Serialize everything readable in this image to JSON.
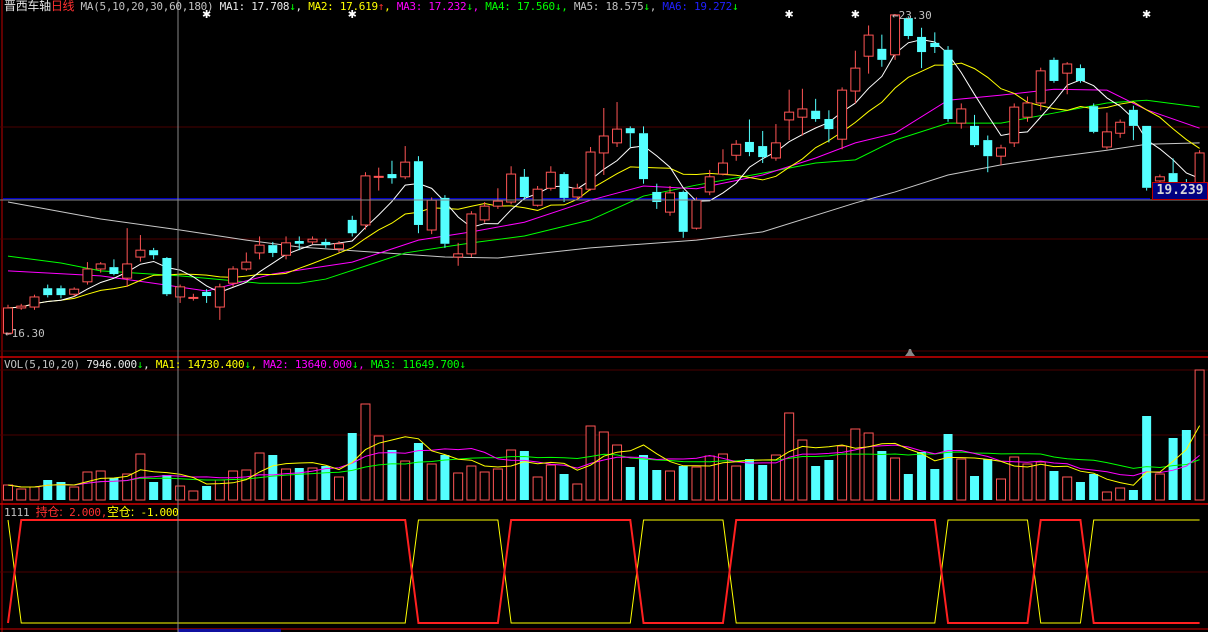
{
  "header": {
    "stock_name": "晋西车轴",
    "period": "日线",
    "ma_label": "MA(5,10,20,30,60,180)",
    "ma": [
      {
        "label": "MA1:",
        "value": "17.708",
        "arrow": "↓"
      },
      {
        "label": "MA2:",
        "value": "17.619",
        "arrow": "↑"
      },
      {
        "label": "MA3:",
        "value": "17.232",
        "arrow": "↓"
      },
      {
        "label": "MA4:",
        "value": "17.560",
        "arrow": "↓"
      },
      {
        "label": "MA5:",
        "value": "18.575",
        "arrow": "↓"
      },
      {
        "label": "MA6:",
        "value": "19.272",
        "arrow": "↓"
      }
    ]
  },
  "volume_header": {
    "label": "VOL(5,10,20)",
    "value": "7946.000",
    "arrow": "↓",
    "ma": [
      {
        "label": "MA1:",
        "value": "14730.400",
        "arrow": "↓"
      },
      {
        "label": "MA2:",
        "value": "13640.000",
        "arrow": "↓"
      },
      {
        "label": "MA3:",
        "value": "11649.700",
        "arrow": "↓"
      }
    ]
  },
  "indicator_header": {
    "name": "1111",
    "hold_label": "持仓:",
    "hold_value": "2.000,",
    "empty_label": "空仓:",
    "empty_value": "-1.000"
  },
  "price_labels": {
    "high": "23.30",
    "low": "16.30",
    "crosshair": "19.239"
  },
  "colors": {
    "up": "#ff5555",
    "down": "#54ffff",
    "ma1": "#ffffff",
    "ma2": "#ffff00",
    "ma3": "#ff00ff",
    "ma4": "#00ff00",
    "ma5": "#c8c8c8",
    "ma6": "#0000ff"
  },
  "chart_data": {
    "type": "candlestick",
    "price_range": [
      16.3,
      23.3
    ],
    "candles_ohlc_order": "open,close,high,low",
    "candles": [
      [
        16.34,
        16.89,
        16.96,
        16.3
      ],
      [
        16.89,
        16.93,
        16.98,
        16.85
      ],
      [
        16.91,
        17.13,
        17.18,
        16.85
      ],
      [
        17.32,
        17.17,
        17.4,
        17.12
      ],
      [
        17.32,
        17.17,
        17.38,
        17.1
      ],
      [
        17.19,
        17.3,
        17.34,
        17.14
      ],
      [
        17.46,
        17.74,
        17.89,
        17.4
      ],
      [
        17.74,
        17.85,
        17.89,
        17.66
      ],
      [
        17.78,
        17.63,
        17.95,
        17.6
      ],
      [
        17.54,
        17.85,
        18.63,
        17.35
      ],
      [
        18.0,
        18.15,
        18.48,
        17.9
      ],
      [
        18.15,
        18.04,
        18.2,
        17.95
      ],
      [
        17.98,
        17.19,
        18.0,
        17.15
      ],
      [
        17.13,
        17.35,
        17.4,
        17.0
      ],
      [
        17.1,
        17.12,
        17.2,
        17.05
      ],
      [
        17.24,
        17.15,
        17.3,
        17.0
      ],
      [
        16.91,
        17.35,
        17.42,
        16.63
      ],
      [
        17.43,
        17.74,
        17.8,
        17.35
      ],
      [
        17.74,
        17.89,
        18.1,
        17.7
      ],
      [
        18.09,
        18.26,
        18.45,
        17.95
      ],
      [
        18.26,
        18.09,
        18.33,
        18.0
      ],
      [
        18.04,
        18.31,
        18.45,
        17.95
      ],
      [
        18.35,
        18.29,
        18.45,
        18.15
      ],
      [
        18.33,
        18.39,
        18.45,
        18.28
      ],
      [
        18.33,
        18.26,
        18.4,
        18.2
      ],
      [
        18.18,
        18.29,
        18.35,
        18.1
      ],
      [
        18.81,
        18.52,
        18.9,
        18.45
      ],
      [
        18.7,
        19.77,
        19.85,
        18.6
      ],
      [
        19.74,
        19.76,
        19.95,
        19.45
      ],
      [
        19.81,
        19.72,
        20.1,
        19.6
      ],
      [
        19.75,
        20.07,
        20.42,
        19.7
      ],
      [
        20.09,
        18.7,
        20.2,
        18.52
      ],
      [
        18.59,
        19.24,
        19.3,
        18.5
      ],
      [
        19.29,
        18.29,
        19.35,
        18.2
      ],
      [
        18.0,
        18.07,
        18.31,
        17.81
      ],
      [
        18.07,
        18.94,
        19.0,
        18.0
      ],
      [
        18.81,
        19.11,
        19.2,
        18.75
      ],
      [
        19.11,
        19.22,
        19.5,
        19.05
      ],
      [
        19.2,
        19.81,
        19.98,
        19.15
      ],
      [
        19.75,
        19.31,
        19.92,
        19.25
      ],
      [
        19.13,
        19.48,
        19.55,
        19.1
      ],
      [
        19.5,
        19.85,
        19.98,
        19.45
      ],
      [
        19.81,
        19.29,
        19.85,
        19.2
      ],
      [
        19.31,
        19.5,
        19.6,
        19.25
      ],
      [
        19.48,
        20.29,
        20.4,
        19.45
      ],
      [
        20.27,
        20.64,
        21.25,
        19.79
      ],
      [
        20.49,
        20.79,
        21.38,
        20.4
      ],
      [
        20.81,
        20.7,
        20.85,
        20.4
      ],
      [
        20.7,
        19.7,
        20.85,
        19.6
      ],
      [
        19.42,
        19.2,
        19.6,
        19.05
      ],
      [
        18.98,
        19.4,
        19.55,
        18.9
      ],
      [
        19.42,
        18.55,
        19.45,
        18.42
      ],
      [
        18.63,
        19.24,
        19.3,
        18.6
      ],
      [
        19.42,
        19.75,
        19.9,
        19.35
      ],
      [
        19.81,
        20.05,
        20.35,
        19.78
      ],
      [
        20.22,
        20.46,
        20.55,
        20.1
      ],
      [
        20.51,
        20.29,
        21.0,
        20.2
      ],
      [
        20.42,
        20.18,
        20.75,
        20.05
      ],
      [
        20.16,
        20.49,
        20.9,
        20.1
      ],
      [
        20.99,
        21.16,
        21.65,
        20.55
      ],
      [
        21.05,
        21.23,
        21.67,
        20.65
      ],
      [
        21.19,
        21.01,
        21.45,
        20.95
      ],
      [
        21.01,
        20.79,
        21.2,
        20.5
      ],
      [
        20.57,
        21.64,
        21.7,
        20.35
      ],
      [
        21.62,
        22.12,
        22.5,
        21.35
      ],
      [
        22.38,
        22.84,
        23.05,
        22.0
      ],
      [
        22.54,
        22.3,
        22.85,
        22.15
      ],
      [
        22.41,
        23.28,
        23.3,
        22.3
      ],
      [
        23.21,
        22.82,
        23.25,
        22.75
      ],
      [
        22.8,
        22.47,
        23.0,
        22.12
      ],
      [
        22.67,
        22.58,
        22.9,
        22.45
      ],
      [
        22.52,
        21.01,
        22.6,
        20.95
      ],
      [
        20.92,
        21.23,
        21.35,
        20.8
      ],
      [
        20.86,
        20.44,
        21.1,
        20.4
      ],
      [
        20.55,
        20.2,
        20.65,
        19.85
      ],
      [
        20.2,
        20.38,
        20.45,
        20.0
      ],
      [
        20.49,
        21.27,
        21.35,
        20.4
      ],
      [
        21.05,
        21.36,
        21.5,
        20.95
      ],
      [
        21.36,
        22.06,
        22.13,
        21.2
      ],
      [
        22.3,
        21.84,
        22.35,
        21.8
      ],
      [
        22.01,
        22.21,
        22.25,
        21.55
      ],
      [
        22.12,
        21.84,
        22.2,
        21.8
      ],
      [
        21.29,
        20.73,
        21.35,
        20.7
      ],
      [
        20.4,
        20.73,
        21.15,
        20.35
      ],
      [
        20.7,
        20.94,
        21.0,
        20.6
      ],
      [
        21.21,
        20.86,
        21.3,
        20.55
      ],
      [
        20.86,
        19.51,
        20.86,
        19.45
      ],
      [
        19.66,
        19.75,
        19.8,
        19.6
      ],
      [
        19.83,
        19.53,
        20.15,
        19.5
      ],
      [
        19.6,
        19.52,
        19.7,
        19.48
      ],
      [
        19.53,
        20.27,
        20.33,
        19.5
      ]
    ],
    "ma20_points": [
      [
        0,
        17.7
      ],
      [
        7,
        17.59
      ],
      [
        11,
        17.43
      ],
      [
        15,
        17.26
      ],
      [
        20,
        17.63
      ],
      [
        26,
        17.89
      ],
      [
        31,
        18.37
      ],
      [
        35,
        18.55
      ],
      [
        39,
        18.76
      ],
      [
        44,
        19.24
      ],
      [
        48,
        19.55
      ],
      [
        52,
        19.49
      ],
      [
        57,
        19.79
      ],
      [
        61,
        20.16
      ],
      [
        64,
        20.49
      ],
      [
        67,
        20.7
      ],
      [
        71,
        21.42
      ],
      [
        75,
        21.53
      ],
      [
        79,
        21.66
      ],
      [
        83,
        21.64
      ],
      [
        86,
        21.21
      ],
      [
        90,
        20.81
      ]
    ],
    "ma30_points": [
      [
        0,
        18.02
      ],
      [
        4,
        17.87
      ],
      [
        7,
        17.7
      ],
      [
        13,
        17.59
      ],
      [
        19,
        17.43
      ],
      [
        22,
        17.43
      ],
      [
        24,
        17.52
      ],
      [
        30,
        18.09
      ],
      [
        35,
        18.31
      ],
      [
        39,
        18.46
      ],
      [
        44,
        18.81
      ],
      [
        48,
        19.33
      ],
      [
        52,
        19.57
      ],
      [
        57,
        19.83
      ],
      [
        61,
        20.05
      ],
      [
        64,
        20.12
      ],
      [
        67,
        20.55
      ],
      [
        71,
        20.92
      ],
      [
        75,
        20.92
      ],
      [
        79,
        21.14
      ],
      [
        83,
        21.36
      ],
      [
        86,
        21.42
      ],
      [
        90,
        21.27
      ]
    ],
    "ma60_points": [
      [
        0,
        19.2
      ],
      [
        7,
        18.83
      ],
      [
        13,
        18.59
      ],
      [
        18,
        18.37
      ],
      [
        22,
        18.22
      ],
      [
        33,
        18.0
      ],
      [
        37,
        17.98
      ],
      [
        44,
        18.2
      ],
      [
        52,
        18.37
      ],
      [
        57,
        18.55
      ],
      [
        64,
        19.18
      ],
      [
        67,
        19.42
      ],
      [
        71,
        19.79
      ],
      [
        75,
        20.01
      ],
      [
        79,
        20.18
      ],
      [
        83,
        20.33
      ],
      [
        86,
        20.46
      ],
      [
        90,
        20.49
      ]
    ],
    "ma180_value": 19.272,
    "volumes": [
      8520,
      6248,
      7384,
      11360,
      10224,
      7384,
      15904,
      16472,
      12496,
      14768,
      26128,
      10224,
      14200,
      7946,
      5112,
      7952,
      11360,
      16472,
      17040,
      26696,
      25560,
      17608,
      18176,
      18176,
      19312,
      13064,
      38056,
      54528,
      36352,
      28400,
      22152,
      32376,
      20448,
      25560,
      15336,
      19312,
      15904,
      17608,
      28400,
      27832,
      13064,
      19880,
      14768,
      9088,
      42032,
      38624,
      31240,
      18744,
      25560,
      17040,
      16472,
      19312,
      18744,
      24992,
      26128,
      19312,
      23288,
      19880,
      25560,
      49416,
      34080,
      19312,
      22720,
      30672,
      40328,
      38056,
      27832,
      23856,
      14768,
      27264,
      17608,
      37488,
      23288,
      13632,
      23288,
      11928,
      24424,
      20448,
      21584,
      16472,
      13064,
      10224,
      14768,
      4544,
      6816,
      5680,
      47712,
      14768,
      35216,
      39760,
      73840
    ],
    "volume_max": 73840,
    "position_hold": [
      0,
      1,
      1,
      1,
      1,
      1,
      1,
      1,
      1,
      1,
      1,
      1,
      1,
      1,
      1,
      1,
      1,
      1,
      1,
      1,
      1,
      1,
      1,
      1,
      1,
      1,
      1,
      1,
      1,
      1,
      1,
      0,
      0,
      0,
      0,
      0,
      0,
      0,
      1,
      1,
      1,
      1,
      1,
      1,
      1,
      1,
      1,
      1,
      0,
      0,
      0,
      0,
      0,
      0,
      0,
      1,
      1,
      1,
      1,
      1,
      1,
      1,
      1,
      1,
      1,
      1,
      1,
      1,
      1,
      1,
      1,
      0,
      0,
      0,
      0,
      0,
      0,
      0,
      1,
      1,
      1,
      1,
      0,
      0,
      0,
      0,
      0,
      0,
      0,
      0,
      0
    ],
    "indicator_range": [
      -1,
      2
    ],
    "signal_markers_candle_index": [
      15,
      26,
      59,
      64,
      86
    ],
    "crosshair_candle_index": 13
  }
}
